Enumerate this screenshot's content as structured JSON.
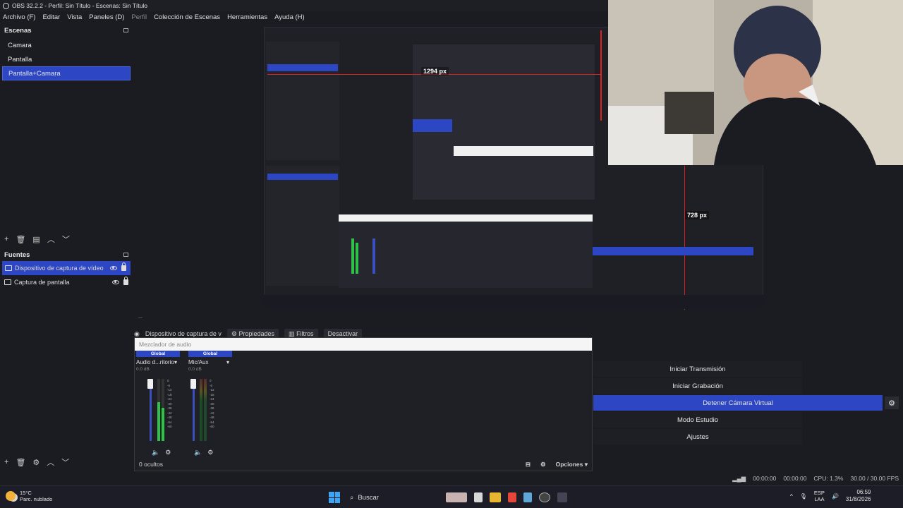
{
  "window": {
    "title": "OBS 32.2.2 - Perfil: Sin Título - Escenas: Sin Título"
  },
  "menu": [
    "Archivo (F)",
    "Editar",
    "Vista",
    "Paneles (D)",
    "Perfil",
    "Colección de Escenas",
    "Herramientas",
    "Ayuda (H)"
  ],
  "scenes": {
    "title": "Escenas",
    "items": [
      "Camara",
      "Pantalla",
      "Pantalla+Camara"
    ],
    "selected_index": 2
  },
  "sources": {
    "title": "Fuentes",
    "items": [
      {
        "name": "Dispositivo de captura de vídeo",
        "selected": true
      },
      {
        "name": "Captura de pantalla",
        "selected": false
      }
    ]
  },
  "preview": {
    "measure_width": "1294 px",
    "measure_height": "728 px"
  },
  "source_toolbar": {
    "source": "Dispositivo de captura de v",
    "properties": "Propiedades",
    "filters": "Filtros",
    "deactivate": "Desactivar"
  },
  "mixer": {
    "title": "Mezclador de audio",
    "channels": [
      {
        "badge": "Global",
        "name": "Audio d...ritorio",
        "db": "0.0 dB",
        "level": 0.62
      },
      {
        "badge": "Global",
        "name": "Mic/Aux",
        "db": "0.0 dB",
        "level": 0.0
      }
    ],
    "ticks": [
      "0",
      "-6",
      "-12",
      "-18",
      "-24",
      "-30",
      "-36",
      "-42",
      "-48",
      "-54",
      "-60"
    ],
    "hidden": "0 ocultos",
    "options": "Opciones"
  },
  "controls": {
    "start_stream": "Iniciar Transmisión",
    "start_record": "Iniciar Grabación",
    "virtual_cam": "Detener Cámara Virtual",
    "studio_mode": "Modo Estudio",
    "settings": "Ajustes"
  },
  "status": {
    "stream_time": "00:00:00",
    "rec_time": "00:00:00",
    "cpu": "CPU: 1.3%",
    "fps": "30.00 / 30.00 FPS"
  },
  "taskbar": {
    "temp": "15°C",
    "weather": "Parc. nublado",
    "search": "Buscar",
    "lang_top": "ESP",
    "lang_bottom": "LAA",
    "time": "06:59",
    "date": "31/8/2026"
  }
}
